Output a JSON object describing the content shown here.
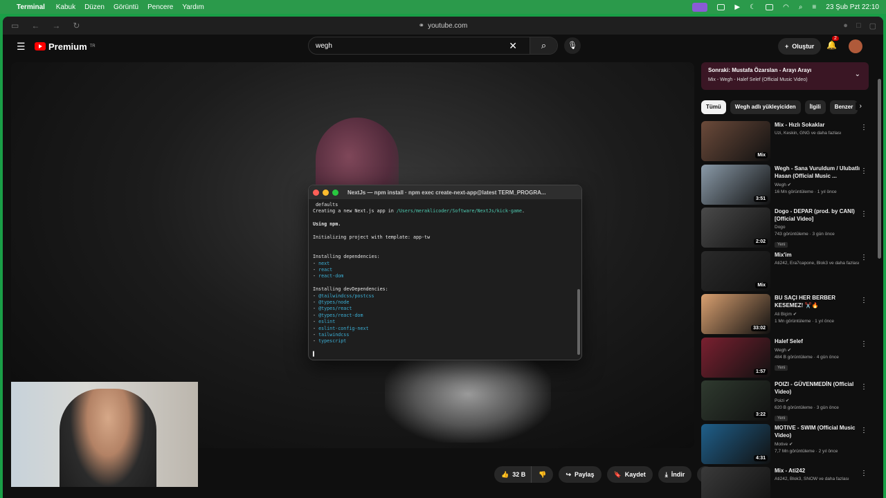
{
  "menubar": {
    "app": "Terminal",
    "items": [
      "Kabuk",
      "Düzen",
      "Görüntü",
      "Pencere",
      "Yardım"
    ],
    "datetime": "23 Şub Pzt  22:10"
  },
  "browser": {
    "url": "youtube.com"
  },
  "youtube": {
    "logo": "Premium",
    "region": "TR",
    "search_value": "wegh",
    "create_label": "Oluştur",
    "notif_count": "2"
  },
  "terminal": {
    "title": "NextJs — npm install · npm exec create-next-app@latest TERM_PROGRA...",
    "lines": [
      {
        "t": " defaults"
      },
      {
        "t": "Creating a new Next.js app in ",
        "g": "/Users/meraklicoder/Software/NextJs/kick-game",
        "e": "."
      },
      {
        "t": ""
      },
      {
        "t": "Using npm.",
        "b": true
      },
      {
        "t": ""
      },
      {
        "t": "Initializing project with template: app-tw"
      },
      {
        "t": ""
      },
      {
        "t": ""
      },
      {
        "t": "Installing dependencies:"
      },
      {
        "t": "- ",
        "p": "next"
      },
      {
        "t": "- ",
        "p": "react"
      },
      {
        "t": "- ",
        "p": "react-dom"
      },
      {
        "t": ""
      },
      {
        "t": "Installing devDependencies:"
      },
      {
        "t": "- ",
        "p": "@tailwindcss/postcss"
      },
      {
        "t": "- ",
        "p": "@types/node"
      },
      {
        "t": "- ",
        "p": "@types/react"
      },
      {
        "t": "- ",
        "p": "@types/react-dom"
      },
      {
        "t": "- ",
        "p": "eslint"
      },
      {
        "t": "- ",
        "p": "eslint-config-next"
      },
      {
        "t": "- ",
        "p": "tailwindcss"
      },
      {
        "t": "- ",
        "p": "typescript"
      },
      {
        "t": ""
      },
      {
        "t": "▌"
      }
    ]
  },
  "actions": {
    "likes": "32 B",
    "share": "Paylaş",
    "save": "Kaydet",
    "download": "İndir"
  },
  "sidebar": {
    "next_title": "Sonraki: Mustafa Özarslan - Arayı Arayı",
    "next_sub": "Mix - Wegh - Halef Selef (Official Music Video)",
    "chips": [
      "Tümü",
      "Wegh adlı yükleyiciden",
      "İlgili",
      "Benzer"
    ],
    "videos": [
      {
        "title": "Mix - Hızlı Sokaklar",
        "channel": "Uzi, Keskin, GNG ve daha fazlası",
        "meta": "",
        "dur": "Mix",
        "new": false,
        "color": "#6b4a3a"
      },
      {
        "title": "Wegh - Sana Vuruldum / Ulubatlı Hasan (Official Music ...",
        "channel": "Wegh ✔",
        "meta": "16 Mn görüntüleme · 1 yıl önce",
        "dur": "3:51",
        "new": false,
        "color": "#8a9aa8"
      },
      {
        "title": "Dogo - DEPAR (prod. by CANI) [Official Video]",
        "channel": "Dogo",
        "meta": "743 görüntüleme · 3 gün önce",
        "dur": "2:02",
        "new": true,
        "color": "#4a4a4a"
      },
      {
        "title": "Mix'im",
        "channel": "Ati242, Era7capone, Blok3 ve daha fazlası",
        "meta": "",
        "dur": "Mix",
        "new": false,
        "color": "#2a2a2a"
      },
      {
        "title": "BU SAÇI HER BERBER KESEMEZ! ✂️🔥",
        "channel": "Ali Biçim ✔",
        "meta": "1 Mn görüntüleme · 1 yıl önce",
        "dur": "33:02",
        "new": false,
        "color": "#d9a070"
      },
      {
        "title": "Halef Selef",
        "channel": "Wegh ✔",
        "meta": "484 B görüntüleme · 4 gün önce",
        "dur": "1:57",
        "new": true,
        "color": "#7a2030"
      },
      {
        "title": "POIZI - GÜVENMEDİN (Official Video)",
        "channel": "Poizi ✔",
        "meta": "620 B görüntüleme · 3 gün önce",
        "dur": "3:22",
        "new": true,
        "color": "#2f3a2f"
      },
      {
        "title": "MOTIVE - SWIM (Official Music Video)",
        "channel": "Motive ✔",
        "meta": "7,7 Mn görüntüleme · 2 yıl önce",
        "dur": "4:31",
        "new": false,
        "color": "#1f5f8a"
      },
      {
        "title": "Mix - Ati242",
        "channel": "Ati242, Blok3, SNOW ve daha fazlası",
        "meta": "",
        "dur": "",
        "new": false,
        "color": "#3a3a3a"
      }
    ]
  }
}
